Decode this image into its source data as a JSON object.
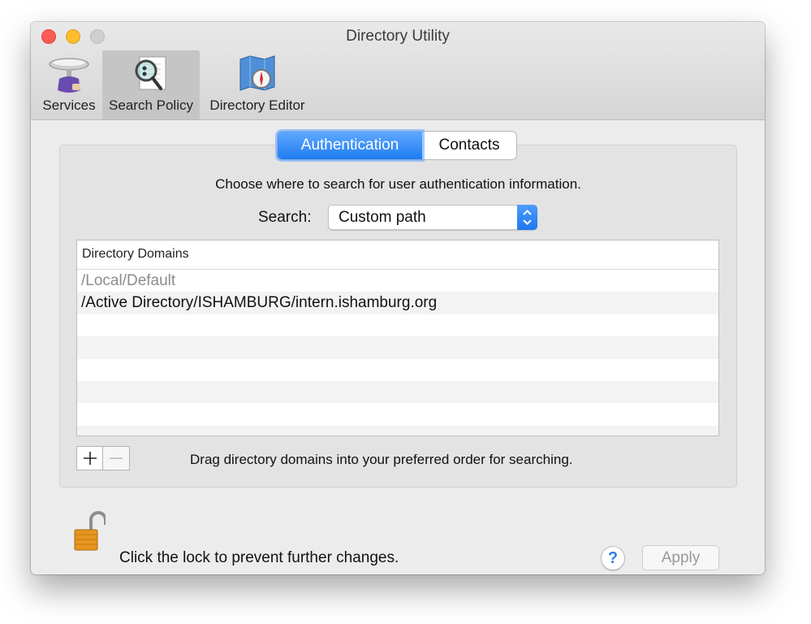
{
  "window": {
    "title": "Directory Utility"
  },
  "toolbar": {
    "items": [
      {
        "label": "Services"
      },
      {
        "label": "Search Policy"
      },
      {
        "label": "Directory Editor"
      }
    ]
  },
  "tabs": {
    "authentication": "Authentication",
    "contacts": "Contacts"
  },
  "panel": {
    "instruction": "Choose where to search for user authentication information.",
    "search_label": "Search:",
    "search_value": "Custom path",
    "table_header": "Directory Domains",
    "domains": [
      "/Local/Default",
      "/Active Directory/ISHAMBURG/intern.ishamburg.org"
    ],
    "drag_note": "Drag directory domains into your preferred order for searching."
  },
  "footer": {
    "lock_text": "Click the lock to prevent further changes.",
    "help": "?",
    "apply": "Apply"
  },
  "colors": {
    "accent": "#1f7cf1",
    "close": "#fd5c55",
    "minimize": "#febc2e"
  }
}
